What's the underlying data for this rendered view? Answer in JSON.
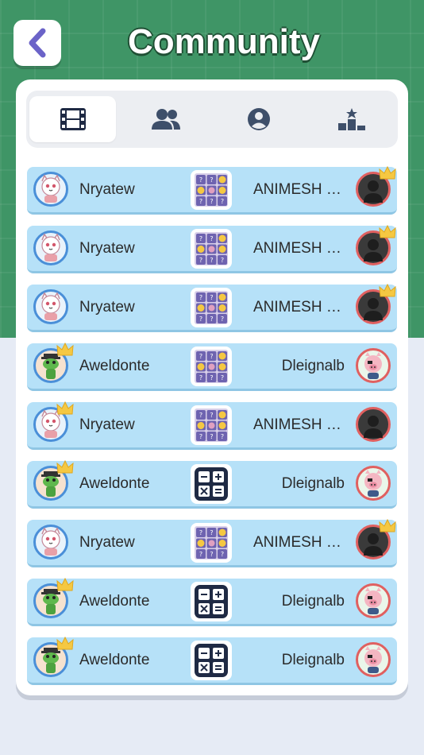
{
  "header": {
    "title": "Community"
  },
  "tabs": [
    {
      "icon": "film-icon",
      "active": true
    },
    {
      "icon": "users-icon",
      "active": false
    },
    {
      "icon": "profile-icon",
      "active": false
    },
    {
      "icon": "podium-icon",
      "active": false
    }
  ],
  "matches": [
    {
      "left": {
        "name": "Nryatew",
        "avatar": "cat-avatar",
        "crown": false
      },
      "game": "puzzle-grid-icon",
      "right": {
        "name": "ANIMESH M...",
        "avatar": "silhouette-avatar",
        "crown": true
      }
    },
    {
      "left": {
        "name": "Nryatew",
        "avatar": "cat-avatar",
        "crown": false
      },
      "game": "puzzle-grid-icon",
      "right": {
        "name": "ANIMESH M...",
        "avatar": "silhouette-avatar",
        "crown": true
      }
    },
    {
      "left": {
        "name": "Nryatew",
        "avatar": "cat-avatar",
        "crown": false
      },
      "game": "puzzle-grid-icon",
      "right": {
        "name": "ANIMESH M...",
        "avatar": "silhouette-avatar",
        "crown": true
      }
    },
    {
      "left": {
        "name": "Aweldonte",
        "avatar": "lizard-avatar",
        "crown": true
      },
      "game": "puzzle-grid-icon",
      "right": {
        "name": "Dleignalb",
        "avatar": "pig-avatar",
        "crown": false
      }
    },
    {
      "left": {
        "name": "Nryatew",
        "avatar": "cat-avatar",
        "crown": true
      },
      "game": "puzzle-grid-icon",
      "right": {
        "name": "ANIMESH M...",
        "avatar": "silhouette-avatar",
        "crown": false
      }
    },
    {
      "left": {
        "name": "Aweldonte",
        "avatar": "lizard-avatar",
        "crown": true
      },
      "game": "calculator-icon",
      "right": {
        "name": "Dleignalb",
        "avatar": "pig-avatar",
        "crown": false
      }
    },
    {
      "left": {
        "name": "Nryatew",
        "avatar": "cat-avatar",
        "crown": false
      },
      "game": "puzzle-grid-icon",
      "right": {
        "name": "ANIMESH M...",
        "avatar": "silhouette-avatar",
        "crown": true
      }
    },
    {
      "left": {
        "name": "Aweldonte",
        "avatar": "lizard-avatar",
        "crown": true
      },
      "game": "calculator-icon",
      "right": {
        "name": "Dleignalb",
        "avatar": "pig-avatar",
        "crown": false
      }
    },
    {
      "left": {
        "name": "Aweldonte",
        "avatar": "lizard-avatar",
        "crown": true
      },
      "game": "calculator-icon",
      "right": {
        "name": "Dleignalb",
        "avatar": "pig-avatar",
        "crown": false
      }
    }
  ],
  "colors": {
    "header_bg": "#3f9566",
    "row_bg": "#b6e1f8",
    "back_icon": "#6b63c8",
    "crown": "#f5c842"
  }
}
